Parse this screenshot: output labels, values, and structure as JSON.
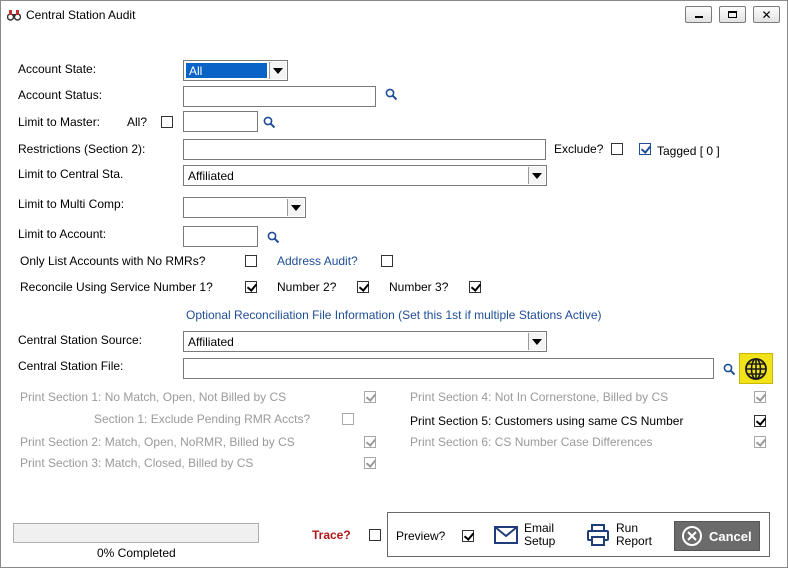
{
  "window": {
    "title": "Central Station Audit",
    "icon": "binoculars-icon",
    "controls": [
      "minimize-icon",
      "maximize-icon",
      "close-icon"
    ]
  },
  "form": {
    "account_state": {
      "label": "Account State:",
      "value": "All"
    },
    "account_status": {
      "label": "Account Status:",
      "value": ""
    },
    "limit_to_master": {
      "label": "Limit to Master:",
      "all_label": "All?",
      "all_checked": false,
      "value": ""
    },
    "restrictions": {
      "label": "Restrictions (Section 2):",
      "value": "",
      "exclude_label": "Exclude?",
      "exclude_checked": false,
      "tagged_label": "Tagged [ 0 ]",
      "tagged_checked": true
    },
    "limit_central": {
      "label": "Limit to Central Sta.",
      "value": "Affiliated"
    },
    "limit_multicomp": {
      "label": "Limit to Multi Comp:",
      "value": ""
    },
    "limit_account": {
      "label": "Limit to Account:",
      "value": ""
    },
    "no_rmrs": {
      "label": "Only List Accounts with No RMRs?",
      "checked": false
    },
    "address_audit": {
      "label": "Address Audit?",
      "checked": false
    },
    "reconcile": {
      "label": "Reconcile Using Service Number 1?",
      "checked": true,
      "number2_label": "Number 2?",
      "number2_checked": true,
      "number3_label": "Number 3?",
      "number3_checked": true
    },
    "optional_header": "Optional Reconciliation File Information (Set this 1st if multiple Stations Active)",
    "cs_source": {
      "label": "Central Station Source:",
      "value": "Affiliated"
    },
    "cs_file": {
      "label": "Central Station File:",
      "value": ""
    }
  },
  "sections": {
    "s1": {
      "label": "Print Section 1: No Match, Open, Not Billed by CS",
      "checked": true,
      "enabled": false
    },
    "s1_excl": {
      "label": "Section 1: Exclude Pending RMR Accts?",
      "checked": false,
      "enabled": false
    },
    "s2": {
      "label": "Print Section 2: Match, Open, NoRMR, Billed by CS",
      "checked": true,
      "enabled": false
    },
    "s3": {
      "label": "Print Section 3: Match, Closed, Billed by CS",
      "checked": true,
      "enabled": false
    },
    "s4": {
      "label": "Print Section 4: Not In Cornerstone, Billed by CS",
      "checked": true,
      "enabled": false
    },
    "s5": {
      "label": "Print Section 5: Customers using same CS Number",
      "checked": true,
      "enabled": true
    },
    "s6": {
      "label": "Print Section 6: CS Number Case Differences",
      "checked": true,
      "enabled": false
    }
  },
  "footer": {
    "progress_label": "0% Completed",
    "progress_value": 0,
    "trace_label": "Trace?",
    "trace_checked": false,
    "preview_label": "Preview?",
    "preview_checked": true,
    "email_setup_line1": "Email",
    "email_setup_line2": "Setup",
    "run_report_line1": "Run",
    "run_report_line2": "Report",
    "cancel_label": "Cancel"
  },
  "colors": {
    "link_blue": "#1f4e96",
    "trace_red": "#b01818",
    "globe_yellow": "#f1e21a",
    "selection_blue": "#0a64c8",
    "cancel_gray": "#6b6b6b"
  }
}
